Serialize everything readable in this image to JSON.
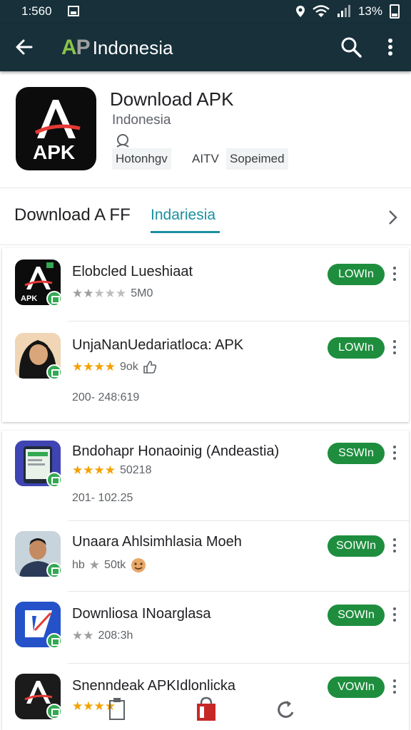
{
  "status_bar": {
    "time": "1:560",
    "battery": "13%"
  },
  "app_bar": {
    "logo_a": "A",
    "logo_p": "P",
    "title": "Indonesia"
  },
  "app": {
    "name": "Download APK",
    "developer": "Indonesia",
    "icon_text": "APK",
    "chips": [
      "Hotonhgv",
      "AITV",
      "Sopeimed"
    ]
  },
  "section": {
    "title": "Download A FF",
    "tab": "Indariesia"
  },
  "colors": {
    "app_bar": "#17303a",
    "accent": "#1a8fa0",
    "button": "#1e8e3e",
    "star": "#f4a100"
  },
  "list": [
    {
      "title": "Elobcled Lueshiaat",
      "stars": 2,
      "star_color": "grey",
      "meta": "5M0",
      "date": "",
      "button": "LOWIn"
    },
    {
      "title": "UnjaNanUedariatloca: APK",
      "stars": 4,
      "star_color": "gold",
      "meta": "9ok",
      "date": "200- 248:619",
      "button": "LOWIn"
    },
    {
      "title": "Bndohapr Honaoinig (Andeastia)",
      "stars": 4,
      "star_color": "gold",
      "meta": "50218",
      "date": "201- 102.25",
      "button": "SSWIn"
    },
    {
      "title": "Unaara Ahlsimhlasia Moeh",
      "stars": 1,
      "star_color": "grey",
      "meta_prefix": "hb",
      "meta": "50tk",
      "date": "",
      "button": "SOIWIn"
    },
    {
      "title": "Downliosa INoarglasa",
      "stars": 2,
      "star_color": "grey",
      "meta": "208:3h",
      "date": "",
      "button": "SOWIn"
    },
    {
      "title": "Snenndeak APKIdlonlicka",
      "stars": 4,
      "star_color": "gold",
      "meta": "",
      "date": "",
      "button": "VOWIn"
    }
  ]
}
